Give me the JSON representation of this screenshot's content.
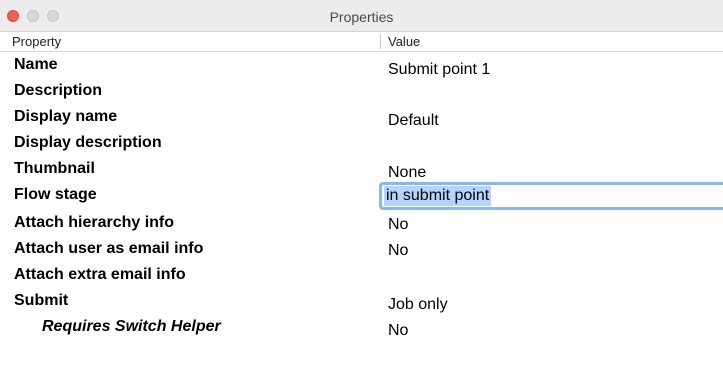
{
  "window": {
    "title": "Properties"
  },
  "header": {
    "property_label": "Property",
    "value_label": "Value"
  },
  "rows": [
    {
      "name": "Name",
      "value": "Submit point 1"
    },
    {
      "name": "Description",
      "value": ""
    },
    {
      "name": "Display name",
      "value": "Default"
    },
    {
      "name": "Display description",
      "value": ""
    },
    {
      "name": "Thumbnail",
      "value": "None"
    },
    {
      "name": "Flow stage",
      "value": "in submit point"
    },
    {
      "name": "Attach hierarchy info",
      "value": "No"
    },
    {
      "name": "Attach user as email info",
      "value": "No"
    },
    {
      "name": "Attach extra email info",
      "value": ""
    },
    {
      "name": "Submit",
      "value": "Job only"
    },
    {
      "name": "Requires Switch Helper",
      "value": "No"
    }
  ],
  "colors": {
    "close_button": "#ee5f57",
    "focus_ring": "#8ab7ee",
    "selection": "#b3d4fc"
  }
}
